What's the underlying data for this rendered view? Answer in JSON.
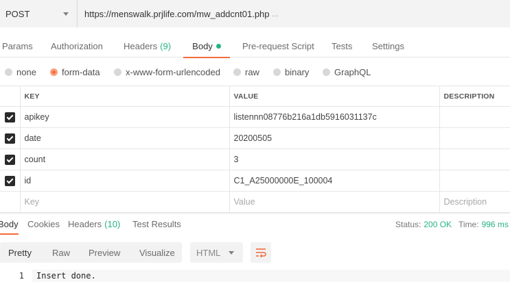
{
  "request": {
    "method": "POST",
    "url": "https://menswalk.prjlife.com/mw_addcnt01.php",
    "url_overflow": "..."
  },
  "tabs": [
    {
      "label": "Params"
    },
    {
      "label": "Authorization"
    },
    {
      "label": "Headers",
      "count": "(9)"
    },
    {
      "label": "Body"
    },
    {
      "label": "Pre-request Script"
    },
    {
      "label": "Tests"
    },
    {
      "label": "Settings"
    }
  ],
  "body_types": [
    {
      "label": "none"
    },
    {
      "label": "form-data"
    },
    {
      "label": "x-www-form-urlencoded"
    },
    {
      "label": "raw"
    },
    {
      "label": "binary"
    },
    {
      "label": "GraphQL"
    }
  ],
  "table": {
    "headers": {
      "key": "KEY",
      "value": "VALUE",
      "description": "DESCRIPTION"
    },
    "rows": [
      {
        "key": "apikey",
        "value": "listennn08776b216a1db5916031137c",
        "description": ""
      },
      {
        "key": "date",
        "value": "20200505",
        "description": ""
      },
      {
        "key": "count",
        "value": "3",
        "description": ""
      },
      {
        "key": "id",
        "value": "C1_A25000000E_100004",
        "description": ""
      }
    ],
    "placeholders": {
      "key": "Key",
      "value": "Value",
      "description": "Description"
    }
  },
  "response": {
    "tabs": [
      {
        "label": "Body"
      },
      {
        "label": "Cookies"
      },
      {
        "label": "Headers",
        "count": "(10)"
      },
      {
        "label": "Test Results"
      }
    ],
    "status_label": "Status:",
    "status_value": "200 OK",
    "time_label": "Time:",
    "time_value": "996 ms",
    "formats": [
      "Pretty",
      "Raw",
      "Preview",
      "Visualize"
    ],
    "language": "HTML",
    "line_number": "1",
    "body_text": "Insert done."
  },
  "colors": {
    "accent": "#f26b3a",
    "count_green": "#26b47f"
  }
}
